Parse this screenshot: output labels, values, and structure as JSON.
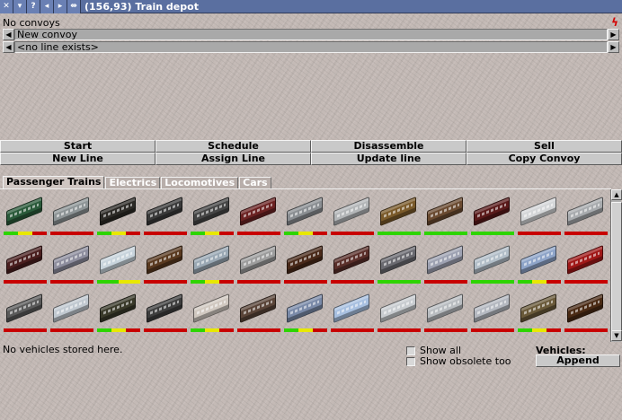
{
  "window": {
    "coords": "(156,93)",
    "title": "Train depot",
    "title_buttons": [
      "close-icon",
      "menu-down-icon",
      "help-icon",
      "prev-icon",
      "next-icon",
      "pin-icon"
    ]
  },
  "convoy_status": "No convoys",
  "convoy_selector": {
    "value": "New convoy"
  },
  "line_selector": {
    "value": "<no line exists>"
  },
  "buttons_row1": [
    "Start",
    "Schedule",
    "Disassemble",
    "Sell"
  ],
  "buttons_row2": [
    "New Line",
    "Assign Line",
    "Update line",
    "Copy Convoy"
  ],
  "tabs": [
    {
      "label": "Passenger Trains",
      "active": true
    },
    {
      "label": "Electrics",
      "active": false
    },
    {
      "label": "Locomotives",
      "active": false
    },
    {
      "label": "Cars",
      "active": false
    }
  ],
  "colors": {
    "titlebar": "#5a6fa0",
    "bar_green": "#2ed400",
    "bar_yellow": "#e8e800",
    "bar_red": "#c80000"
  },
  "vehicles": [
    {
      "color": "#2a5a3a",
      "bar": "gyr"
    },
    {
      "color": "#8d9496",
      "bar": "r"
    },
    {
      "color": "#2c2a26",
      "bar": "gyr"
    },
    {
      "color": "#3a3a3a",
      "bar": "r"
    },
    {
      "color": "#454545",
      "bar": "gyr"
    },
    {
      "color": "#6b2222",
      "bar": "r"
    },
    {
      "color": "#8a8e92",
      "bar": "gyr"
    },
    {
      "color": "#b3b6b8",
      "bar": "r"
    },
    {
      "color": "#7a5a2a",
      "bar": "g"
    },
    {
      "color": "#6a4a30",
      "bar": "g"
    },
    {
      "color": "#5a1a1a",
      "bar": "g"
    },
    {
      "color": "#d4d6d8",
      "bar": "r"
    },
    {
      "color": "#a8abae",
      "bar": "r"
    },
    {
      "color": "#4a1f1f",
      "bar": "r"
    },
    {
      "color": "#8e8e9e",
      "bar": "r"
    },
    {
      "color": "#c8d4dc",
      "bar": "gy"
    },
    {
      "color": "#5a3a20",
      "bar": "r"
    },
    {
      "color": "#9aa8b4",
      "bar": "gyr"
    },
    {
      "color": "#9c9c9c",
      "bar": "r"
    },
    {
      "color": "#4a2a1a",
      "bar": "r"
    },
    {
      "color": "#5a2f2a",
      "bar": "r"
    },
    {
      "color": "#6a6a70",
      "bar": "g"
    },
    {
      "color": "#9ea2b2",
      "bar": "r"
    },
    {
      "color": "#b2bec8",
      "bar": "g"
    },
    {
      "color": "#8ea4c8",
      "bar": "gyr"
    },
    {
      "color": "#a01818",
      "bar": "r"
    },
    {
      "color": "#5a5a5a",
      "bar": "r"
    },
    {
      "color": "#c0c8d0",
      "bar": "r"
    },
    {
      "color": "#3a3a2a",
      "bar": "gyr"
    },
    {
      "color": "#3e3e3e",
      "bar": "r"
    },
    {
      "color": "#d0c8c0",
      "bar": "gyr"
    },
    {
      "color": "#5a4438",
      "bar": "r"
    },
    {
      "color": "#7a8aa8",
      "bar": "gyr"
    },
    {
      "color": "#a8c0e0",
      "bar": "r"
    },
    {
      "color": "#c8ccd0",
      "bar": "r"
    },
    {
      "color": "#b8bcc0",
      "bar": "r"
    },
    {
      "color": "#b4b8c0",
      "bar": "r"
    },
    {
      "color": "#6a5a3a",
      "bar": "gyr"
    },
    {
      "color": "#4a2a14",
      "bar": "r"
    }
  ],
  "status_text": "No vehicles stored here.",
  "checkboxes": {
    "show_all": "Show all",
    "show_obsolete": "Show obsolete too"
  },
  "vehicles_label": "Vehicles:",
  "append_label": "Append"
}
